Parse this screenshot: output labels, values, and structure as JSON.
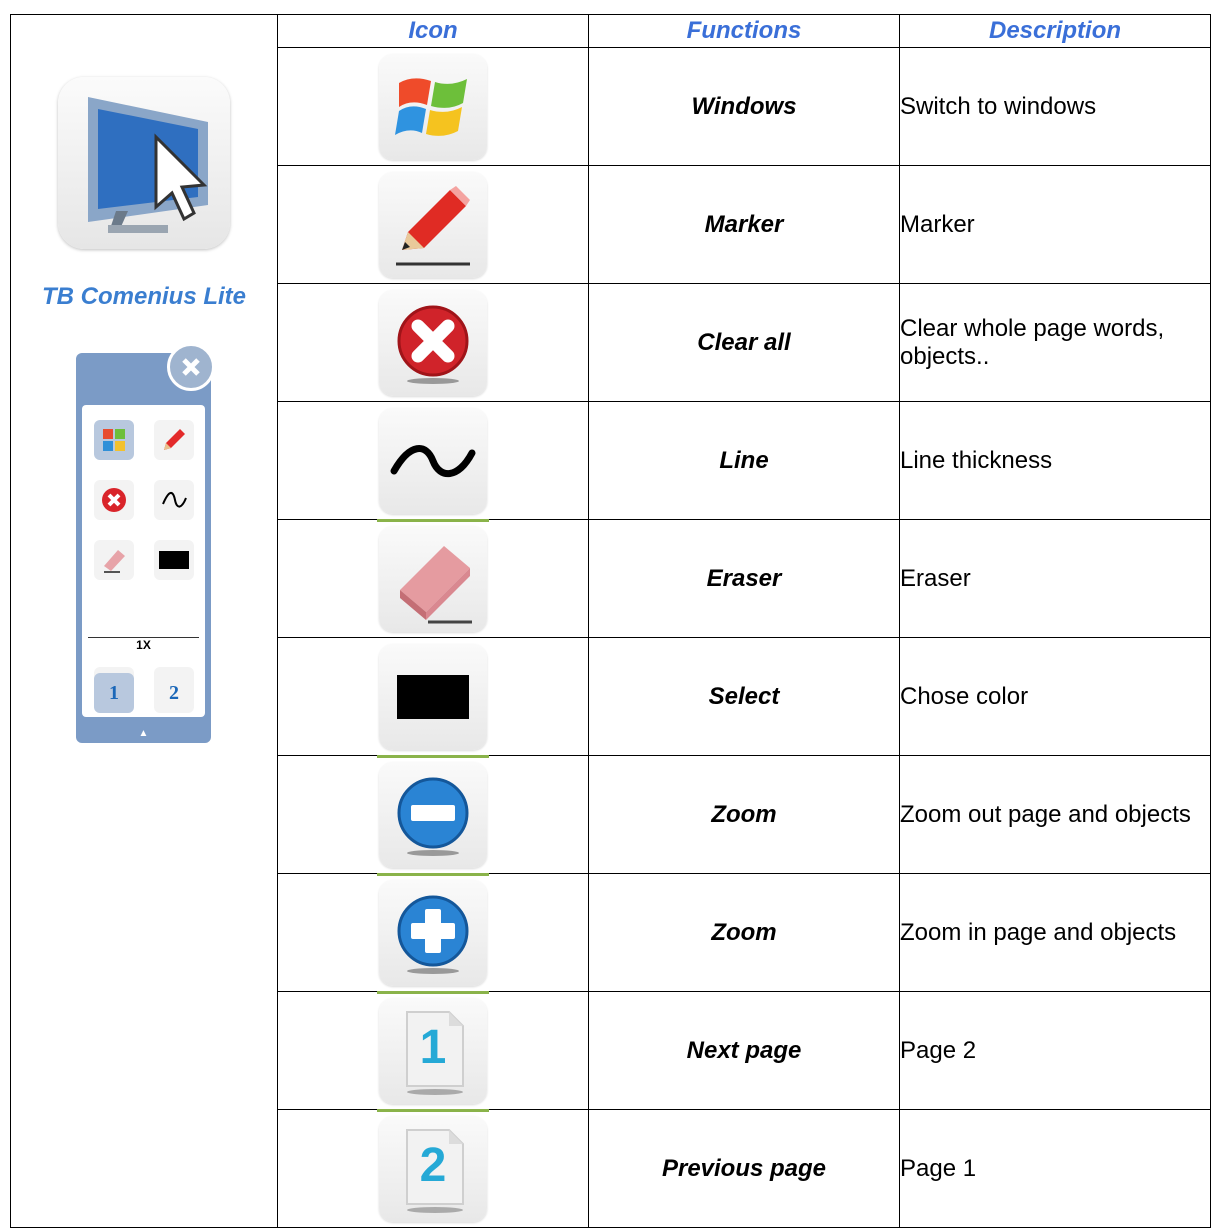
{
  "header": {
    "col_icon": "Icon",
    "col_functions": "Functions",
    "col_description": "Description"
  },
  "app": {
    "name": "TB Comenius Lite",
    "zoom_level": "1X"
  },
  "rows": [
    {
      "icon": "windows-logo-icon",
      "function": "Windows",
      "description": "Switch to windows"
    },
    {
      "icon": "pencil-icon",
      "function": "Marker",
      "description": "Marker"
    },
    {
      "icon": "red-x-icon",
      "function": "Clear all",
      "description": "Clear whole page words, objects.."
    },
    {
      "icon": "wave-line-icon",
      "function": "Line",
      "description": "Line thickness"
    },
    {
      "icon": "eraser-icon",
      "function": "Eraser",
      "description": "Eraser"
    },
    {
      "icon": "black-rectangle-icon",
      "function": "Select",
      "description": "Chose color"
    },
    {
      "icon": "minus-circle-icon",
      "function": "Zoom",
      "description": "Zoom out page and objects"
    },
    {
      "icon": "plus-circle-icon",
      "function": "Zoom",
      "description": "Zoom in page and objects"
    },
    {
      "icon": "page-1-icon",
      "function": "Next page",
      "description": "Page 2"
    },
    {
      "icon": "page-2-icon",
      "function": "Previous page",
      "description": "Page 1"
    }
  ],
  "page_labels": {
    "one": "1",
    "two": "2"
  }
}
